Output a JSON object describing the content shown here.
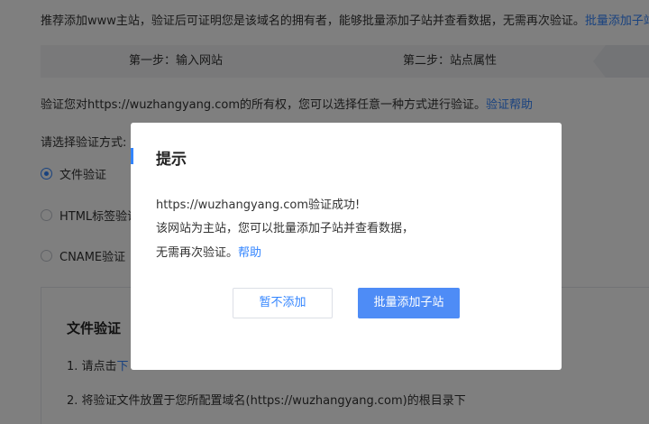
{
  "intro": {
    "text": "推荐添加www主站，验证后可证明您是该域名的拥有者，能够批量添加子站并查看数据，无需再次验证。",
    "link": "批量添加子站"
  },
  "steps": [
    {
      "label": "第一步：输入网站"
    },
    {
      "label": "第二步：站点属性"
    }
  ],
  "verify": {
    "text": "验证您对https://wuzhangyang.com的所有权，您可以选择任意一种方式进行验证。",
    "link": "验证帮助"
  },
  "method_label": "请选择验证方式:",
  "methods": [
    {
      "label": "文件验证",
      "selected": true
    },
    {
      "label": "HTML标签验证",
      "selected": false
    },
    {
      "label": "CNAME验证",
      "selected": false
    }
  ],
  "file_panel": {
    "title": "文件验证",
    "step1_prefix": "1. 请点击",
    "step1_link": "下",
    "step2": "2. 将验证文件放置于您所配置域名(https://wuzhangyang.com)的根目录下"
  },
  "dialog": {
    "title": "提示",
    "line1": "https://wuzhangyang.com验证成功!",
    "line2": "该网站为主站，您可以批量添加子站并查看数据，",
    "line3_text": "无需再次验证。",
    "line3_link": "帮助",
    "cancel_label": "暂不添加",
    "primary_label": "批量添加子站"
  },
  "colors": {
    "accent": "#3385ff",
    "primary_button": "#4e8cf6",
    "overlay": "rgba(0,0,0,0.5)"
  }
}
